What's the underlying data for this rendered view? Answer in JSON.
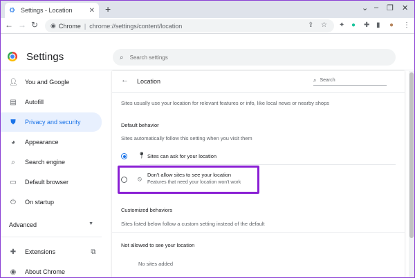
{
  "browser": {
    "tab_title": "Settings - Location",
    "tab_close": "✕",
    "new_tab": "+",
    "url_scheme": "Chrome",
    "url": "chrome://settings/content/location"
  },
  "header": {
    "title": "Settings",
    "search_placeholder": "Search settings"
  },
  "sidebar": {
    "items": [
      {
        "label": "You and Google",
        "icon": "person-icon"
      },
      {
        "label": "Autofill",
        "icon": "clipboard-icon"
      },
      {
        "label": "Privacy and security",
        "icon": "shield-icon",
        "active": true
      },
      {
        "label": "Appearance",
        "icon": "palette-icon"
      },
      {
        "label": "Search engine",
        "icon": "search-icon"
      },
      {
        "label": "Default browser",
        "icon": "browser-icon"
      },
      {
        "label": "On startup",
        "icon": "power-icon"
      }
    ],
    "advanced": "Advanced",
    "extensions": "Extensions",
    "about": "About Chrome"
  },
  "content": {
    "title": "Location",
    "search_placeholder": "Search",
    "intro": "Sites usually use your location for relevant features or info, like local news or nearby shops",
    "default_behavior_heading": "Default behavior",
    "default_behavior_desc": "Sites automatically follow this setting when you visit them",
    "option_allow": "Sites can ask for your location",
    "option_block": "Don't allow sites to see your location",
    "option_block_sub": "Features that need your location won't work",
    "customized_heading": "Customized behaviors",
    "customized_desc": "Sites listed below follow a custom setting instead of the default",
    "not_allowed_heading": "Not allowed to see your location",
    "no_sites": "No sites added"
  },
  "colors": {
    "accent": "#1a73e8",
    "highlight_box": "#8a1fd4"
  }
}
